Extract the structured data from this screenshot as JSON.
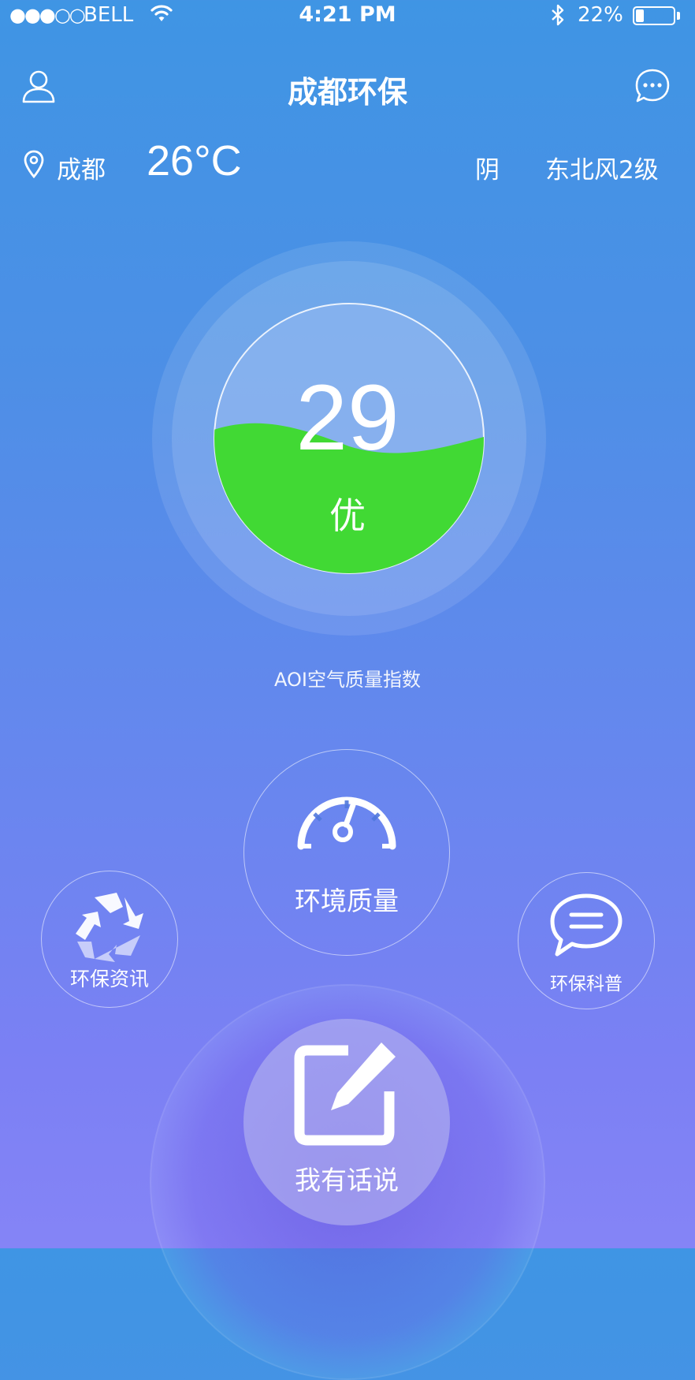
{
  "status_bar": {
    "signal": "●●●○○",
    "carrier": "BELL",
    "time": "4:21 PM",
    "battery_percent": "22%",
    "battery_level": 0.22
  },
  "nav": {
    "title": "成都环保",
    "left_icon": "profile-icon",
    "right_icon": "chat-icon"
  },
  "weather": {
    "city": "成都",
    "temperature": "26°C",
    "condition": "阴",
    "wind": "东北风2级"
  },
  "aqi": {
    "value": "29",
    "level": "优",
    "caption": "AOI空气质量指数",
    "fill_color": "#41d934"
  },
  "actions": {
    "environment_quality": "环境质量",
    "env_news": "环保资讯",
    "env_science": "环保科普",
    "speak": "我有话说"
  }
}
